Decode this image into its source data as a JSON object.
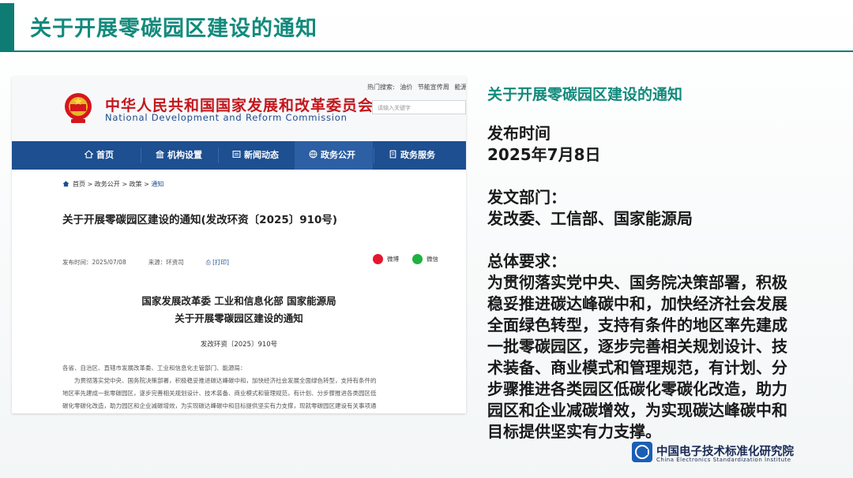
{
  "slide": {
    "title": "关于开展零碳园区建设的通知"
  },
  "screenshot": {
    "org_name_cn": "中华人民共和国国家发展和改革委员会",
    "org_name_en": "National Development and Reform Commission",
    "hot_search_label": "热门搜索:",
    "hot_search_terms": [
      "油价",
      "节能宣传周",
      "能源"
    ],
    "search_placeholder": "请输入关键字",
    "nav": [
      {
        "label": "首页",
        "icon": "home-icon"
      },
      {
        "label": "机构设置",
        "icon": "building-icon"
      },
      {
        "label": "新闻动态",
        "icon": "news-icon"
      },
      {
        "label": "政务公开",
        "icon": "globe-icon"
      },
      {
        "label": "政务服务",
        "icon": "document-icon"
      }
    ],
    "breadcrumb": [
      "首页",
      "政务公开",
      "政策",
      "通知"
    ],
    "breadcrumb_sep": ">",
    "doc_title": "关于开展零碳园区建设的通知(发改环资〔2025〕910号)",
    "publish_label": "发布时间：",
    "publish_date": "2025/07/08",
    "source_label": "来源：",
    "source_value": "环资司",
    "print_label": "[打印]",
    "share_weibo": "微博",
    "share_wechat": "微信",
    "issuer_line1": "国家发展改革委 工业和信息化部 国家能源局",
    "issuer_line2": "关于开展零碳园区建设的通知",
    "doc_number": "发改环资〔2025〕910号",
    "body_lines": [
      "各省、自治区、直辖市发展改革委、工业和信息化主管部门、能源局：",
      "　　为贯彻落实党中央、国务院决策部署，积极稳妥推进碳达峰碳中和，加快经济社会发展全面绿色转型，支持有条件的",
      "地区率先建成一批零碳园区，逐步完善相关规划设计、技术装备、商业模式和管理规范，有计划、分步骤推进各类园区低",
      "碳化零碳化改造，助力园区和企业减碳增效，为实现碳达峰碳中和目标提供坚实有力支撑，现就零碳园区建设有关事项通"
    ],
    "colors": {
      "nav_bg": "#1d4f91",
      "org_red": "#c4161c",
      "org_en_blue": "#1c4a8c"
    }
  },
  "right": {
    "title": "关于开展零碳园区建设的通知",
    "date_heading": "发布时间",
    "date_value": "2025年7月8日",
    "dept_heading": "发文部门：",
    "dept_value": "发改委、工信部、国家能源局",
    "req_heading": "总体要求：",
    "req_lines": [
      "为贯彻落实党中央、国务院决策部署，积极",
      "稳妥推进碳达峰碳中和，加快经济社会发展",
      "全面绿色转型，支持有条件的地区率先建成",
      "一批零碳园区，逐步完善相关规划设计、技",
      "术装备、商业模式和管理规范，有计划、分",
      "步骤推进各类园区低碳化零碳化改造，助力",
      "园区和企业减碳增效，为实现碳达峰碳中和",
      "目标提供坚实有力支撑。"
    ]
  },
  "footer": {
    "logo_cn": "中国电子技术标准化研究院",
    "logo_en": "China Electronics Standardization Institute",
    "logo_mark_text": "CESI"
  },
  "colors": {
    "accent": "#128a7c",
    "accent_dark": "#0e7c73"
  }
}
